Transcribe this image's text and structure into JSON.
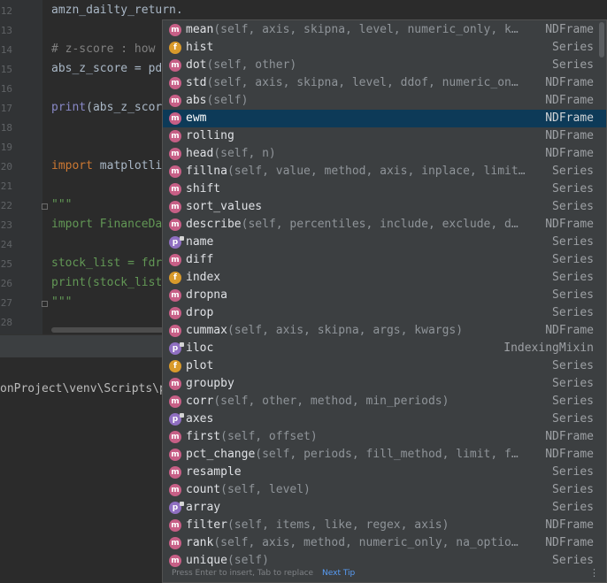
{
  "editor": {
    "line_numbers": [
      "12",
      "13",
      "14",
      "15",
      "16",
      "17",
      "18",
      "19",
      "20",
      "21",
      "22",
      "23",
      "24",
      "25",
      "26",
      "27",
      "28"
    ],
    "lines": {
      "l12": "amzn_dailty_return.",
      "l14": "# z-score : how",
      "l15": "abs_z_score = pd",
      "l17_fn": "print",
      "l17_rest": "(abs_z_scor",
      "l20_kw": "import",
      "l20_rest": " matplotli",
      "l22": "\"\"\"",
      "l23_kw": "import",
      "l23_rest": " FinanceDa",
      "l25": "stock_list = fdr",
      "l26": "print(stock_list",
      "l27": "\"\"\""
    }
  },
  "terminal": {
    "path_text": "onProject\\venv\\Scripts\\p"
  },
  "completion": {
    "items": [
      {
        "kind": "m",
        "name": "mean",
        "sig": "(self, axis, skipna, level, numeric_only, k…",
        "type": "NDFrame"
      },
      {
        "kind": "f",
        "name": "hist",
        "sig": "",
        "type": "Series"
      },
      {
        "kind": "m",
        "name": "dot",
        "sig": "(self, other)",
        "type": "Series"
      },
      {
        "kind": "m",
        "name": "std",
        "sig": "(self, axis, skipna, level, ddof, numeric_on…",
        "type": "NDFrame"
      },
      {
        "kind": "m",
        "name": "abs",
        "sig": "(self)",
        "type": "NDFrame"
      },
      {
        "kind": "m",
        "name": "ewm",
        "sig": "",
        "type": "NDFrame"
      },
      {
        "kind": "m",
        "name": "rolling",
        "sig": "",
        "type": "NDFrame"
      },
      {
        "kind": "m",
        "name": "head",
        "sig": "(self, n)",
        "type": "NDFrame"
      },
      {
        "kind": "m",
        "name": "fillna",
        "sig": "(self, value, method, axis, inplace, limit…",
        "type": "Series"
      },
      {
        "kind": "m",
        "name": "shift",
        "sig": "",
        "type": "Series"
      },
      {
        "kind": "m",
        "name": "sort_values",
        "sig": "",
        "type": "Series"
      },
      {
        "kind": "m",
        "name": "describe",
        "sig": "(self, percentiles, include, exclude, d…",
        "type": "NDFrame"
      },
      {
        "kind": "p",
        "name": "name",
        "sig": "",
        "type": "Series"
      },
      {
        "kind": "m",
        "name": "diff",
        "sig": "",
        "type": "Series"
      },
      {
        "kind": "f",
        "name": "index",
        "sig": "",
        "type": "Series"
      },
      {
        "kind": "m",
        "name": "dropna",
        "sig": "",
        "type": "Series"
      },
      {
        "kind": "m",
        "name": "drop",
        "sig": "",
        "type": "Series"
      },
      {
        "kind": "m",
        "name": "cummax",
        "sig": "(self, axis, skipna, args, kwargs)",
        "type": "NDFrame"
      },
      {
        "kind": "p",
        "name": "iloc",
        "sig": "",
        "type": "IndexingMixin"
      },
      {
        "kind": "f",
        "name": "plot",
        "sig": "",
        "type": "Series"
      },
      {
        "kind": "m",
        "name": "groupby",
        "sig": "",
        "type": "Series"
      },
      {
        "kind": "m",
        "name": "corr",
        "sig": "(self, other, method, min_periods)",
        "type": "Series"
      },
      {
        "kind": "p",
        "name": "axes",
        "sig": "",
        "type": "Series"
      },
      {
        "kind": "m",
        "name": "first",
        "sig": "(self, offset)",
        "type": "NDFrame"
      },
      {
        "kind": "m",
        "name": "pct_change",
        "sig": "(self, periods, fill_method, limit, f…",
        "type": "NDFrame"
      },
      {
        "kind": "m",
        "name": "resample",
        "sig": "",
        "type": "Series"
      },
      {
        "kind": "m",
        "name": "count",
        "sig": "(self, level)",
        "type": "Series"
      },
      {
        "kind": "p",
        "name": "array",
        "sig": "",
        "type": "Series"
      },
      {
        "kind": "m",
        "name": "filter",
        "sig": "(self, items, like, regex, axis)",
        "type": "NDFrame"
      },
      {
        "kind": "m",
        "name": "rank",
        "sig": "(self, axis, method, numeric_only, na_optio…",
        "type": "NDFrame"
      },
      {
        "kind": "m",
        "name": "unique",
        "sig": "(self)",
        "type": "Series"
      }
    ],
    "selected_index": 5,
    "footer_hint": "Press Enter to insert, Tab to replace",
    "next_tip": "Next Tip"
  },
  "colors": {
    "selection": "#0d3a58",
    "method_badge": "#c75f86",
    "field_badge": "#d99a2b",
    "property_badge": "#8f6fc1"
  }
}
